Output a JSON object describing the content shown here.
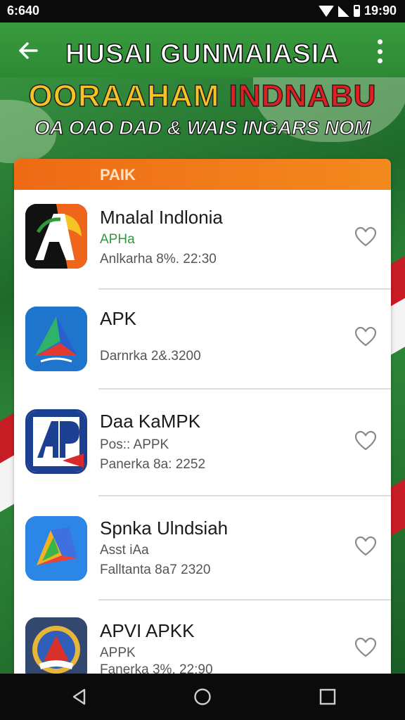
{
  "status": {
    "time_left": "6:640",
    "time_right": "19:90"
  },
  "app_bar": {
    "title": "HUSAI GUNMAIASIA"
  },
  "headline": {
    "line1_a": "OORAAHAM ",
    "line1_b": "INDNABU",
    "line2": "OA OAO DAD & WAIS INGARS NOM"
  },
  "list": {
    "header": "PAIK",
    "items": [
      {
        "title": "Mnalal Indlonia",
        "subtitle": "APHa",
        "date": "Anlkarha 8%. 22:30",
        "icon": "orange-black-a-app-icon"
      },
      {
        "title": "APK",
        "subtitle": "",
        "date": "Darnrka 2&.3200",
        "icon": "blue-arrow-app-icon"
      },
      {
        "title": "Daa KaMPK",
        "subtitle": "Pos:: APPK",
        "date": "Panerka 8a: 2252",
        "icon": "ap-logo-app-icon"
      },
      {
        "title": "Spnka Ulndsiah",
        "subtitle": "Asst iAa",
        "date": "Falltanta 8a7 2320",
        "icon": "colorful-folder-app-icon"
      },
      {
        "title": "APVI APKK",
        "subtitle": "APPK",
        "date": "Fanerka 3%. 22:90",
        "icon": "emblem-app-icon"
      }
    ]
  },
  "colors": {
    "app_bar": "#2c8a33",
    "accent_orange": "#ee6a16",
    "subtitle_green": "#2e9b3a"
  }
}
